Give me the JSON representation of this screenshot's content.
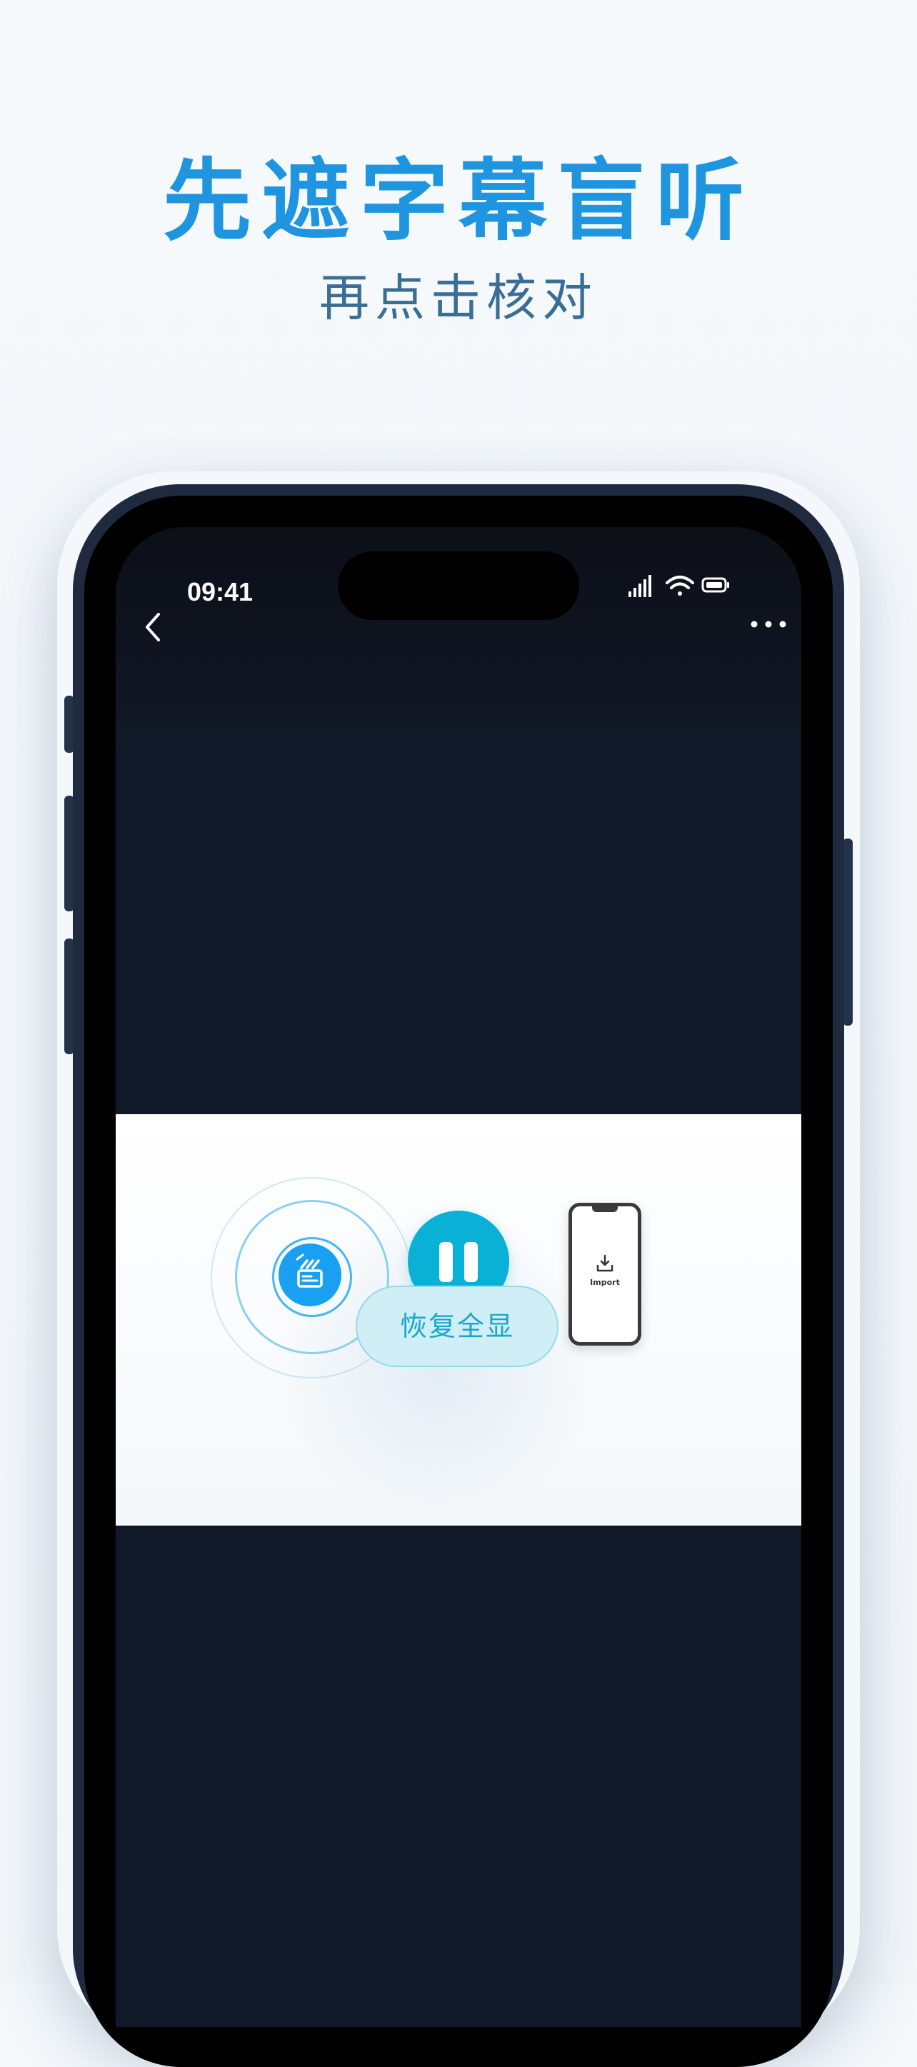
{
  "promo": {
    "headline": "先遮字幕盲听",
    "subheadline": "再点击核对"
  },
  "status_bar": {
    "time": "09:41"
  },
  "player": {
    "restore_label": "恢复全显",
    "import_label": "Import"
  },
  "icons": {
    "back": "chevron-left-icon",
    "more": "more-horizontal-icon",
    "signal": "cellular-signal-icon",
    "wifi": "wifi-icon",
    "battery": "battery-icon",
    "subtitle": "subtitle-toggle-icon",
    "pause": "pause-icon",
    "import": "download-icon"
  },
  "colors": {
    "headline": "#1e95de",
    "subheadline": "#3a6e95",
    "accent_blue": "#1aa0f2",
    "accent_teal": "#0ab1d6",
    "screen_bg": "#111827"
  }
}
